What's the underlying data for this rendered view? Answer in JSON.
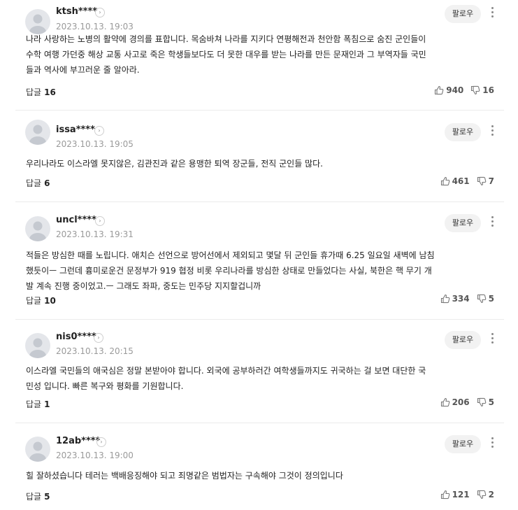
{
  "follow_label": "팔로우",
  "reply_label": "답글",
  "arrow_glyph": "›",
  "comments": [
    {
      "username": "ktsh****",
      "date": "2023.10.13. 19:03",
      "text": "나라 사랑하는 노병의 활약에 경의를 표합니다. 목숨바쳐 나라를 지키다 연평해전과 천안함 폭침으로 숨진 군인들이\n수학 여행 가던중 해상 교통 사고로 죽은 학생들보다도 더 못한 대우를 받는 나라를 만든 문재인과 그 부역자들 국민\n들과 역사에 부끄러운 줄 알아라.",
      "replies": "16",
      "likes": "940",
      "dislikes": "16"
    },
    {
      "username": "issa****",
      "date": "2023.10.13. 19:05",
      "text": "우리나라도 이스라엘 못지않은, 김관진과 같은 용맹한 퇴역 장군들, 전직 군인들 많다.",
      "replies": "6",
      "likes": "461",
      "dislikes": "7"
    },
    {
      "username": "uncl****",
      "date": "2023.10.13. 19:31",
      "text": "적들은 방심한 때를 노립니다. 애치슨 선언으로 방어선에서 제외되고 몇달 뒤 군인들 휴가때 6.25 일요일 새벽에 남침\n했듯이ㅡ 그런데 흉미로운건 문정부가 919 협정 비롯 우리나라를 방심한 상태로 만들었다는 사실, 북한은 핵 무기 개\n발 계속 진행 중이었고.ㅡ 그래도 좌파, 중도는 민주당 지지할겁니까",
      "replies": "10",
      "likes": "334",
      "dislikes": "5"
    },
    {
      "username": "nis0****",
      "date": "2023.10.13. 20:15",
      "text": "이스라엘 국민들의 애국심은 정말 본받아야 합니다. 외국에 공부하러간 여학생들까지도 귀국하는 걸 보면 대단한 국\n민성 입니다. 빠른 복구와 평화를 기원합니다.",
      "replies": "1",
      "likes": "206",
      "dislikes": "5"
    },
    {
      "username": "12ab****",
      "date": "2023.10.13. 19:00",
      "text": "힐 잘하셨습니다 테러는 백배응징해야 되고 죄명같은 범법자는 구속해야 그것이 정의입니다",
      "replies": "5",
      "likes": "121",
      "dislikes": "2"
    }
  ]
}
